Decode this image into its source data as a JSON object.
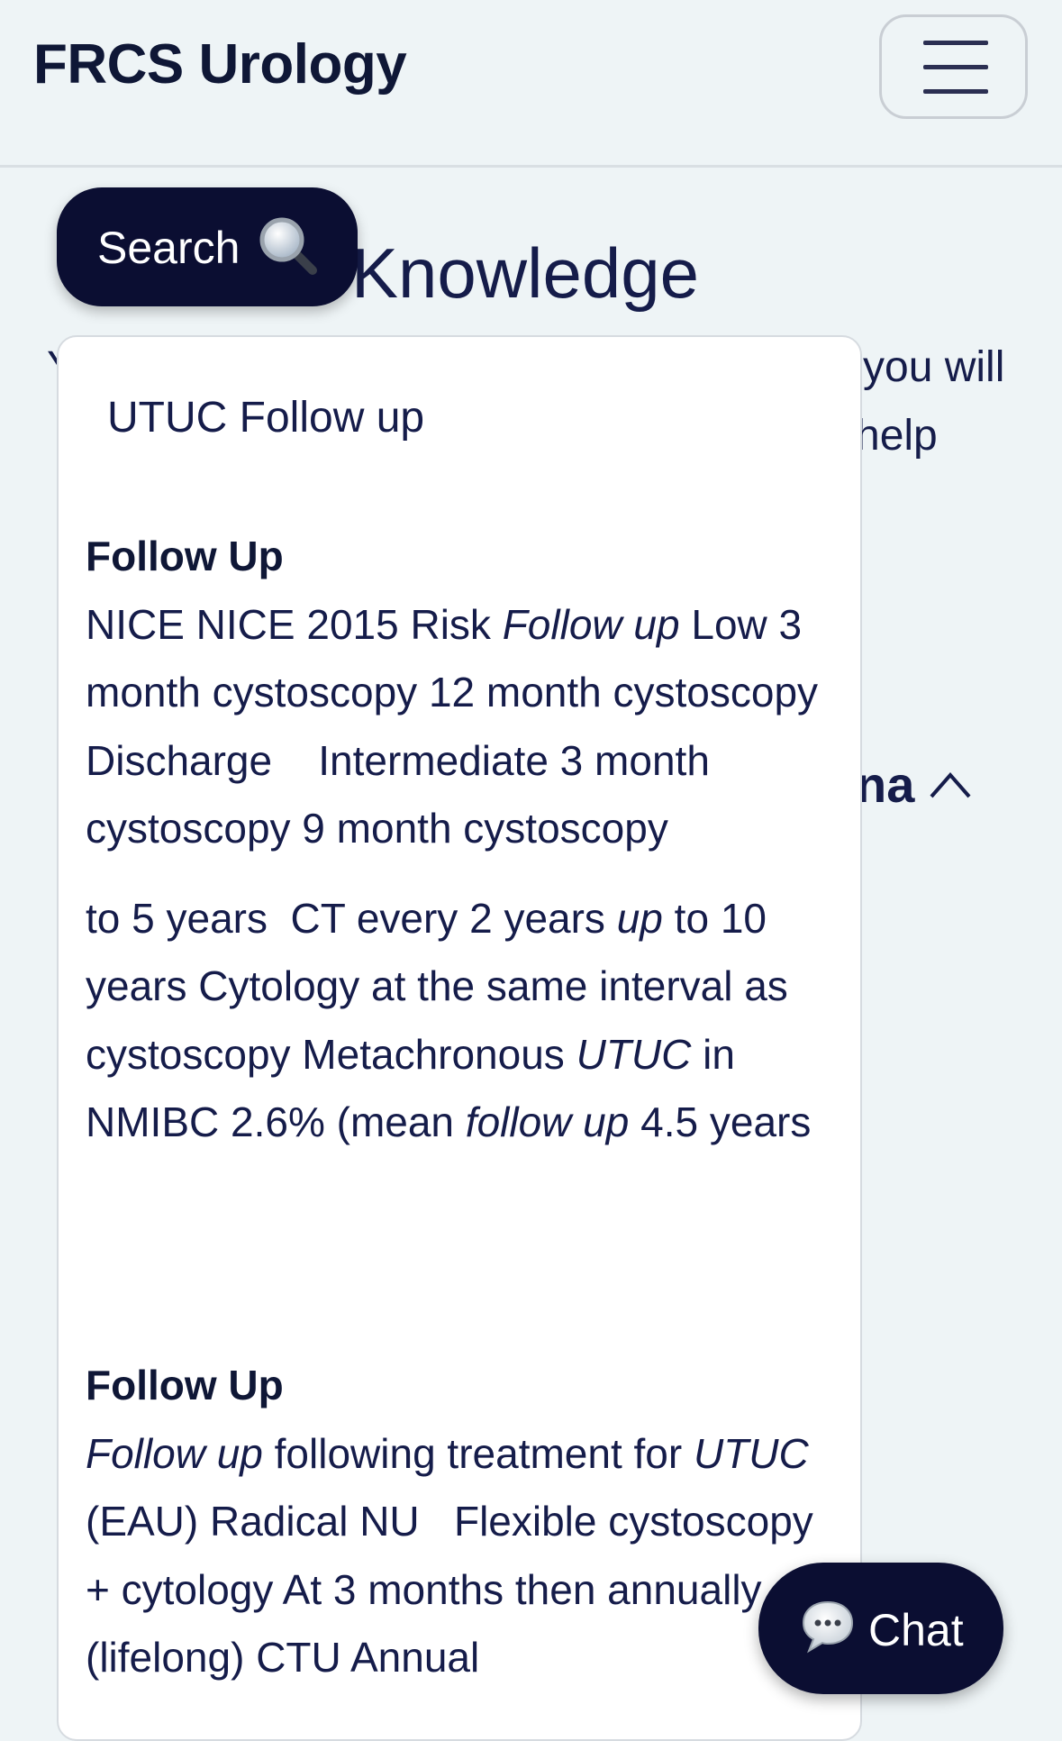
{
  "navbar": {
    "brand": "FRCS Urology",
    "menu_icon": "hamburger-icon"
  },
  "background": {
    "heading": "Knowledge",
    "intro_line1_fragment": "you will",
    "intro_line2_fragment": "help",
    "intro_prefix": "Y",
    "accordion_fragment": "na",
    "accordion_icon": "chevron-up-icon"
  },
  "search": {
    "label": "Search",
    "icon": "magnifier-icon"
  },
  "result": {
    "title": "UTUC Follow up",
    "sections": [
      {
        "heading": "Follow Up",
        "paragraphs": [
          [
            {
              "t": "NICE NICE 2015 Risk "
            },
            {
              "t": "Follow up",
              "em": true
            },
            {
              "t": " Low 3 month cystoscopy 12 month cystoscopy Discharge    Intermediate 3 month cystoscopy 9 month cystoscopy"
            }
          ],
          [
            {
              "t": "to 5 years  CT every 2 years "
            },
            {
              "t": "up",
              "em": true
            },
            {
              "t": " to 10 years Cytology at the same interval as cystoscopy Metachronous "
            },
            {
              "t": "UTUC",
              "em": true
            },
            {
              "t": " in NMIBC 2.6% (mean "
            },
            {
              "t": "follow up",
              "em": true
            },
            {
              "t": " 4.5 years"
            }
          ]
        ]
      },
      {
        "heading": "Follow Up",
        "paragraphs": [
          [
            {
              "t": "Follow up",
              "em": true
            },
            {
              "t": " following treatment for "
            },
            {
              "t": "UTUC",
              "em": true
            },
            {
              "t": " (EAU) Radical NU   Flexible cystoscopy + cytology At 3 months then annually (lifelong) CTU Annual"
            }
          ]
        ]
      }
    ]
  },
  "chat": {
    "label": "Chat",
    "icon": "speech-bubble-icon"
  }
}
